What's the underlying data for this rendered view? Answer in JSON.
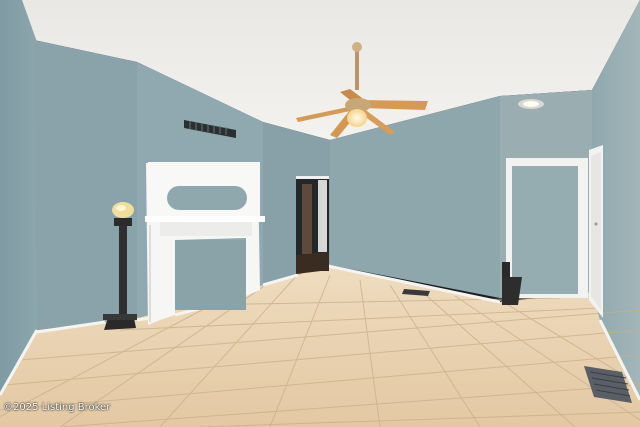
{
  "photo": {
    "kind": "interior-real-estate-photo",
    "watermark": "©2025 Listing Broker",
    "colors": {
      "wall": "#8ca5ac",
      "wall_light": "#9cb4ba",
      "ceiling": "#ecebe8",
      "floor_tile": "#e6cfae",
      "grout": "#c8b08c",
      "trim": "#f4f4f2",
      "fan_blade": "#d69a55"
    }
  }
}
